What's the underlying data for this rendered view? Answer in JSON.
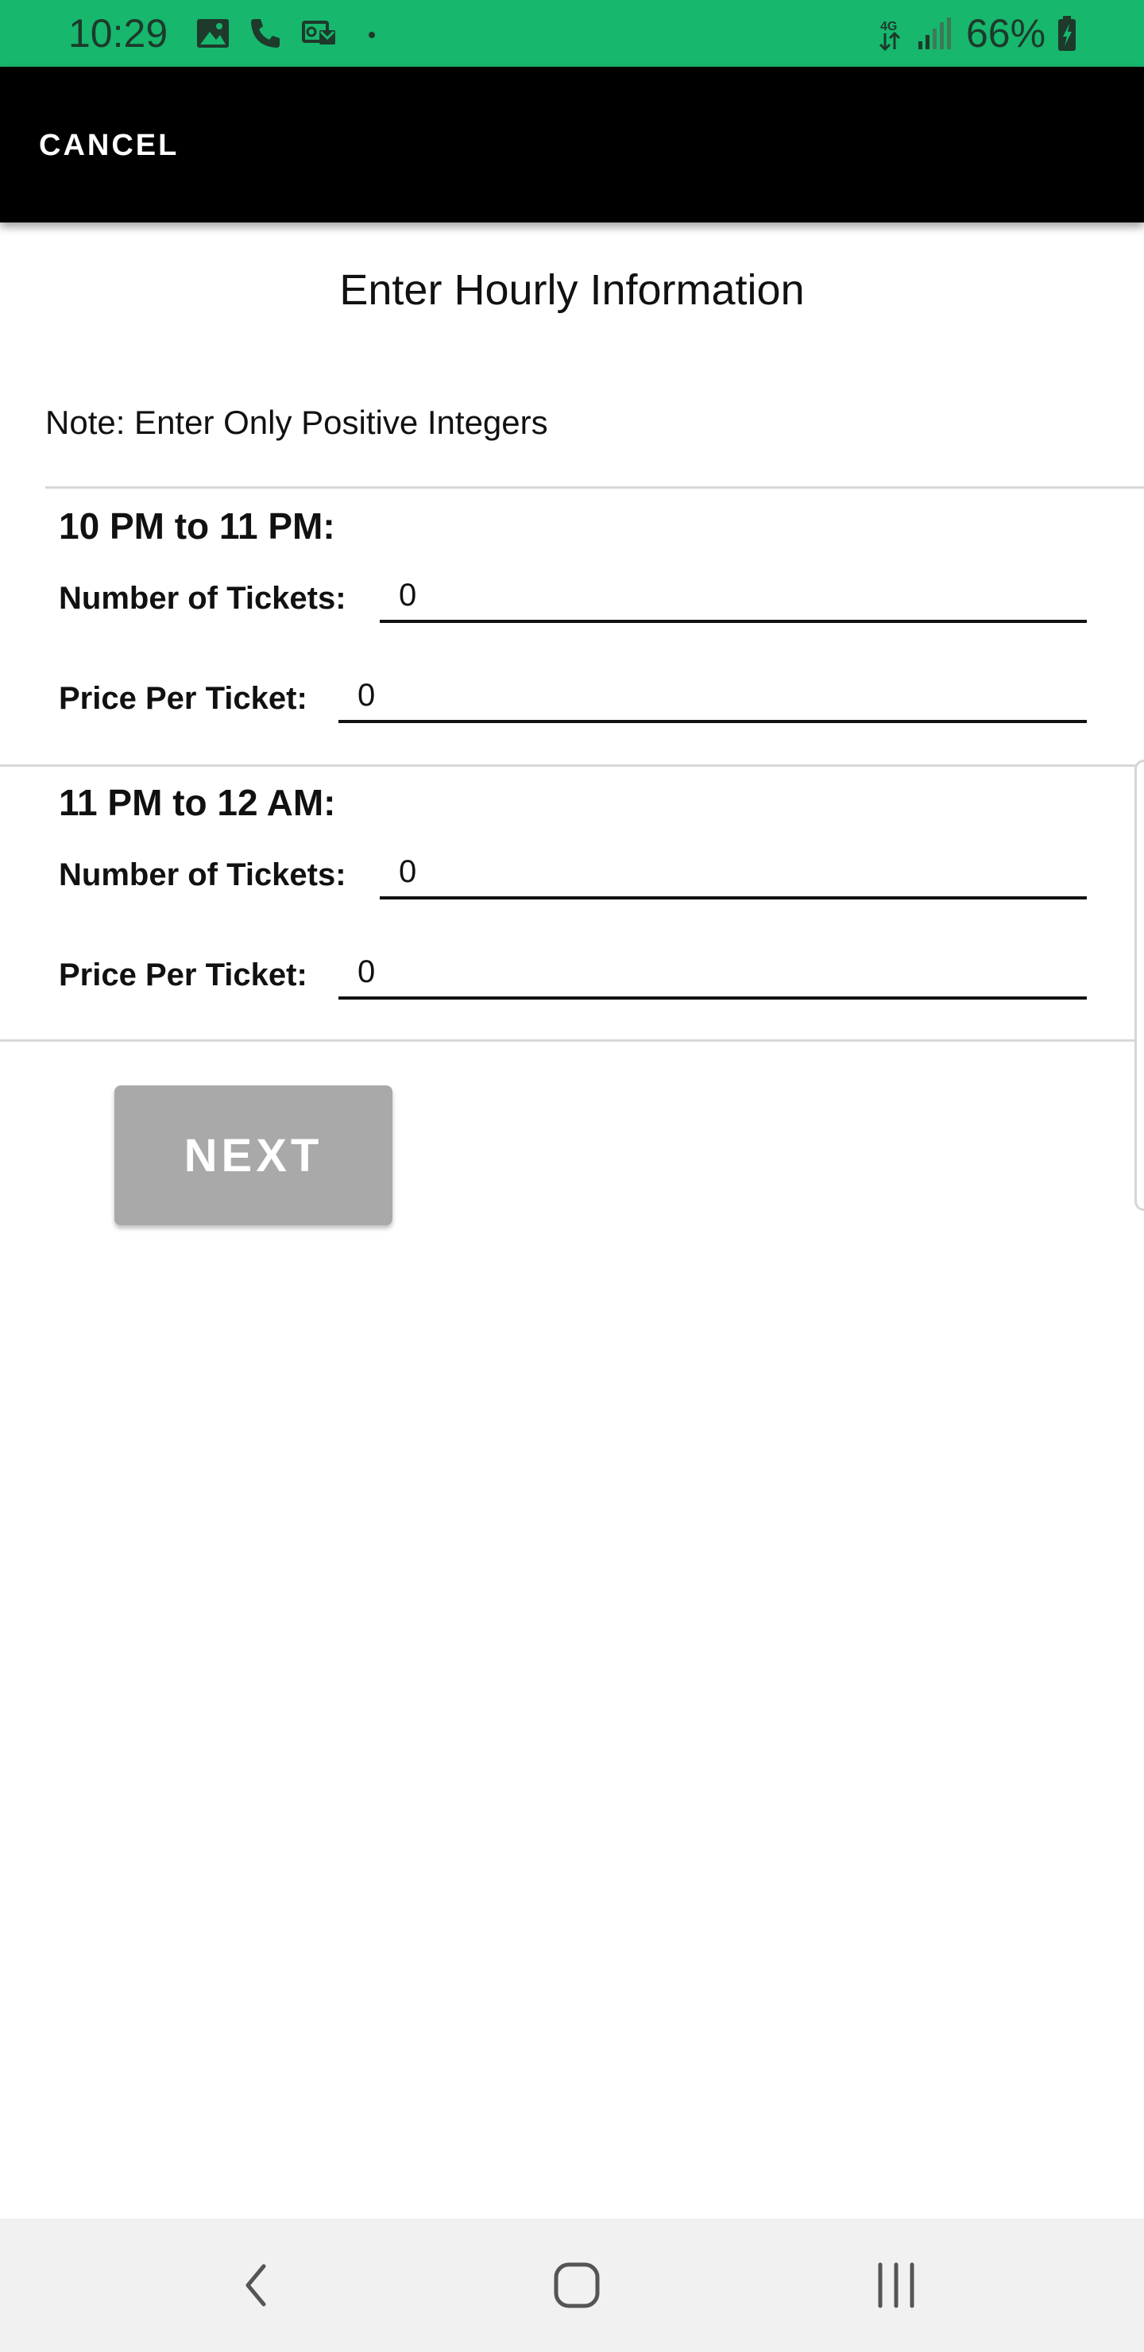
{
  "status_bar": {
    "time": "10:29",
    "battery_percent": "66%",
    "color": "#17b76d",
    "icons": [
      "image-icon",
      "phone-icon",
      "voicemail-icon",
      "dot-icon",
      "data-4g-icon",
      "signal-icon",
      "battery-charging-icon"
    ]
  },
  "app_bar": {
    "cancel_label": "CANCEL"
  },
  "page": {
    "title": "Enter Hourly Information",
    "note": "Note: Enter Only Positive Integers"
  },
  "slots": [
    {
      "title": "10 PM to 11 PM:",
      "tickets_label": "Number of Tickets:",
      "tickets_value": "0",
      "price_label": "Price Per Ticket:",
      "price_value": "0"
    },
    {
      "title": "11 PM to 12 AM:",
      "tickets_label": "Number of Tickets:",
      "tickets_value": "0",
      "price_label": "Price Per Ticket:",
      "price_value": "0"
    }
  ],
  "next_label": "NEXT",
  "nav_bar": {
    "icons": [
      "back-icon",
      "home-icon",
      "recent-apps-icon"
    ]
  }
}
